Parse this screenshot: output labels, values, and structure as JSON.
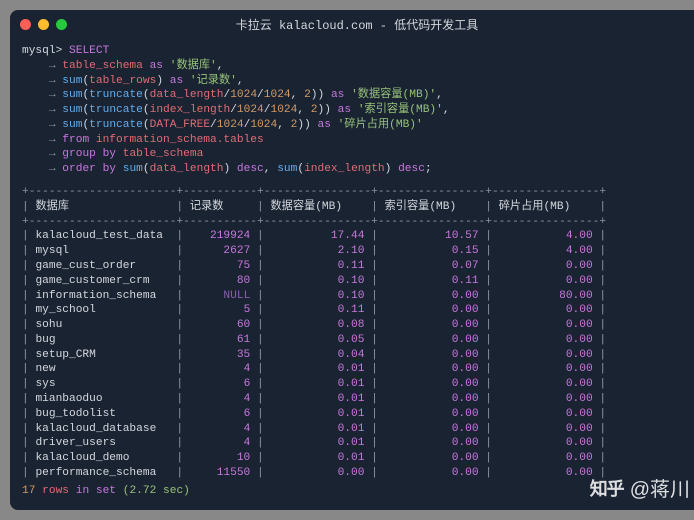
{
  "window": {
    "title": "卡拉云 kalacloud.com - 低代码开发工具"
  },
  "query": {
    "prompt": "mysql>",
    "arrow": "→",
    "kw_select": "SELECT",
    "kw_as": "as",
    "kw_from": "from",
    "kw_group_by": "group by",
    "kw_order_by": "order by",
    "kw_desc": "desc",
    "fn_sum": "sum",
    "fn_truncate": "truncate",
    "col_table_schema": "table_schema",
    "col_table_rows": "table_rows",
    "col_data_length": "data_length",
    "col_index_length": "index_length",
    "col_DATA_FREE": "DATA_FREE",
    "from_table": "information_schema.tables",
    "lit_1024": "1024",
    "lit_2": "2",
    "alias_db": "'数据库'",
    "alias_rows": "'记录数'",
    "alias_data_mb": "'数据容量(MB)'",
    "alias_index_mb": "'索引容量(MB)'",
    "alias_frag_mb": "'碎片占用(MB)'"
  },
  "table": {
    "headers": [
      "数据库",
      "记录数",
      "数据容量(MB)",
      "索引容量(MB)",
      "碎片占用(MB)"
    ],
    "rows": [
      {
        "name": "kalacloud_test_data",
        "rows": "219924",
        "data_mb": "17.44",
        "index_mb": "10.57",
        "frag_mb": "4.00"
      },
      {
        "name": "mysql",
        "rows": "2627",
        "data_mb": "2.10",
        "index_mb": "0.15",
        "frag_mb": "4.00"
      },
      {
        "name": "game_cust_order",
        "rows": "75",
        "data_mb": "0.11",
        "index_mb": "0.07",
        "frag_mb": "0.00"
      },
      {
        "name": "game_customer_crm",
        "rows": "80",
        "data_mb": "0.10",
        "index_mb": "0.11",
        "frag_mb": "0.00"
      },
      {
        "name": "information_schema",
        "rows": "NULL",
        "data_mb": "0.10",
        "index_mb": "0.00",
        "frag_mb": "80.00"
      },
      {
        "name": "my_school",
        "rows": "5",
        "data_mb": "0.11",
        "index_mb": "0.00",
        "frag_mb": "0.00"
      },
      {
        "name": "sohu",
        "rows": "60",
        "data_mb": "0.08",
        "index_mb": "0.00",
        "frag_mb": "0.00"
      },
      {
        "name": "bug",
        "rows": "61",
        "data_mb": "0.05",
        "index_mb": "0.00",
        "frag_mb": "0.00"
      },
      {
        "name": "setup_CRM",
        "rows": "35",
        "data_mb": "0.04",
        "index_mb": "0.00",
        "frag_mb": "0.00"
      },
      {
        "name": "new",
        "rows": "4",
        "data_mb": "0.01",
        "index_mb": "0.00",
        "frag_mb": "0.00"
      },
      {
        "name": "sys",
        "rows": "6",
        "data_mb": "0.01",
        "index_mb": "0.00",
        "frag_mb": "0.00"
      },
      {
        "name": "mianbaoduo",
        "rows": "4",
        "data_mb": "0.01",
        "index_mb": "0.00",
        "frag_mb": "0.00"
      },
      {
        "name": "bug_todolist",
        "rows": "6",
        "data_mb": "0.01",
        "index_mb": "0.00",
        "frag_mb": "0.00"
      },
      {
        "name": "kalacloud_database",
        "rows": "4",
        "data_mb": "0.01",
        "index_mb": "0.00",
        "frag_mb": "0.00"
      },
      {
        "name": "driver_users",
        "rows": "4",
        "data_mb": "0.01",
        "index_mb": "0.00",
        "frag_mb": "0.00"
      },
      {
        "name": "kalacloud_demo",
        "rows": "10",
        "data_mb": "0.01",
        "index_mb": "0.00",
        "frag_mb": "0.00"
      },
      {
        "name": "performance_schema",
        "rows": "11550",
        "data_mb": "0.00",
        "index_mb": "0.00",
        "frag_mb": "0.00"
      }
    ]
  },
  "status": {
    "rows_count": "17",
    "rows_word": "rows",
    "in_set": "in set",
    "time": "(2.72 sec)"
  },
  "watermark": {
    "logo": "知乎",
    "author": "@蒋川"
  },
  "layout": {
    "col_widths_ch": [
      20,
      9,
      14,
      14,
      14
    ]
  }
}
